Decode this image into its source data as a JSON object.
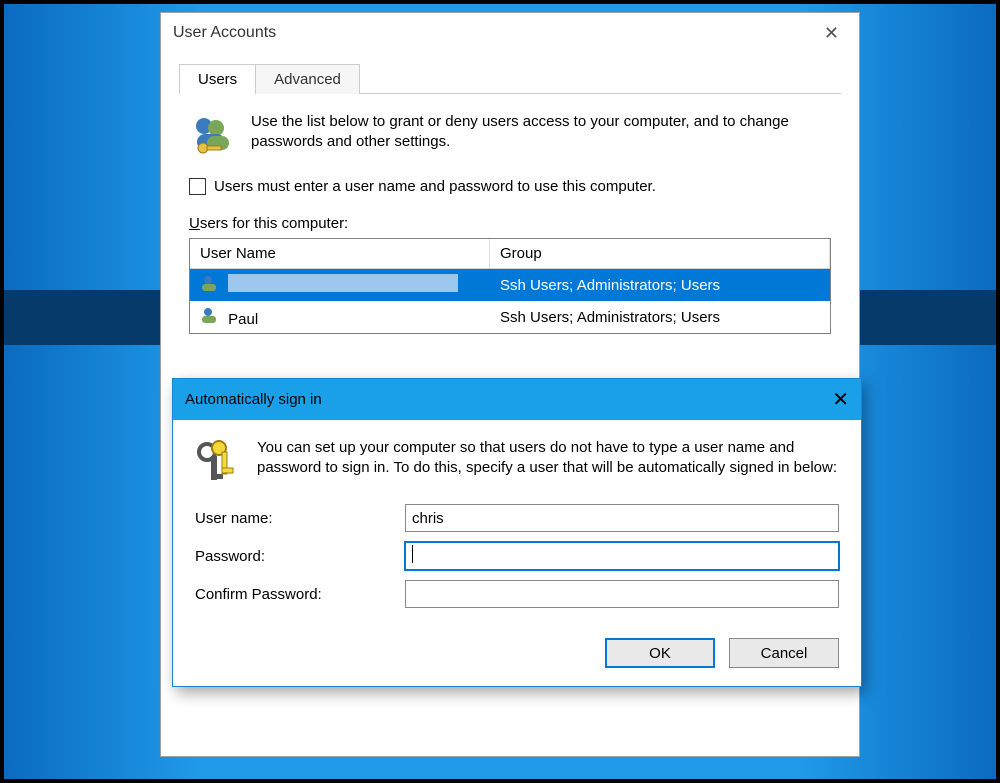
{
  "window": {
    "title": "User Accounts",
    "tabs": {
      "users": "Users",
      "advanced": "Advanced"
    },
    "intro": "Use the list below to grant or deny users access to your computer, and to change passwords and other settings.",
    "checkbox_label": "Users must enter a user name and password to use this computer.",
    "list_label_prefix": "U",
    "list_label_rest": "sers for this computer:",
    "columns": {
      "name": "User Name",
      "group": "Group"
    },
    "rows": [
      {
        "name": "",
        "group": "Ssh Users; Administrators; Users",
        "selected": true
      },
      {
        "name": "Paul",
        "group": "Ssh Users; Administrators; Users",
        "selected": false
      }
    ]
  },
  "dialog": {
    "title": "Automatically sign in",
    "intro": "You can set up your computer so that users do not have to type a user name and password to sign in. To do this, specify a user that will be automatically signed in below:",
    "labels": {
      "username": "User name:",
      "password": "Password:",
      "confirm": "Confirm Password:"
    },
    "values": {
      "username": "chris",
      "password": "",
      "confirm": ""
    },
    "buttons": {
      "ok": "OK",
      "cancel": "Cancel"
    }
  }
}
